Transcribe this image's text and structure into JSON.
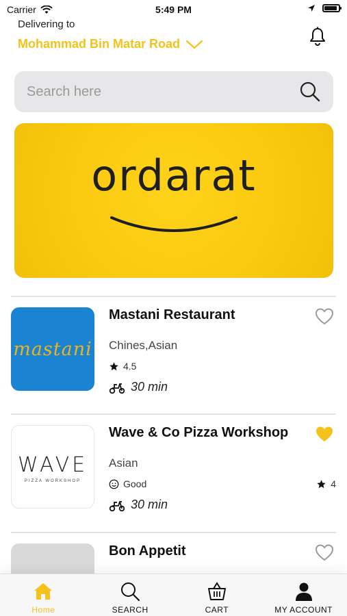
{
  "status_bar": {
    "carrier": "Carrier",
    "time": "5:49 PM"
  },
  "header": {
    "delivering_label": "Delivering to",
    "address": "Mohammad Bin Matar Road",
    "accent_color": "#f4c21b"
  },
  "search": {
    "placeholder": "Search here"
  },
  "banner": {
    "brand": "ordarat",
    "background": "#f9c90f"
  },
  "restaurants": [
    {
      "name": "Mastani Restaurant",
      "logo_text": "mastani",
      "cuisine": "Chines,Asian",
      "rating": "4.5",
      "eta": "30 min",
      "favorite": false
    },
    {
      "name": "Wave & Co Pizza Workshop",
      "logo_text": "WAVE",
      "logo_subtext": "PIZZA WORKSHOP",
      "cuisine": "Asian",
      "review_label": "Good",
      "rating": "4",
      "eta": "30 min",
      "favorite": true
    },
    {
      "name": "Bon Appetit",
      "favorite": false
    }
  ],
  "tabbar": {
    "items": [
      {
        "label": "Home",
        "icon": "home-icon",
        "active": true
      },
      {
        "label": "SEARCH",
        "icon": "search-icon",
        "active": false
      },
      {
        "label": "CART",
        "icon": "cart-icon",
        "active": false
      },
      {
        "label": "MY ACCOUNT",
        "icon": "account-icon",
        "active": false
      }
    ]
  }
}
